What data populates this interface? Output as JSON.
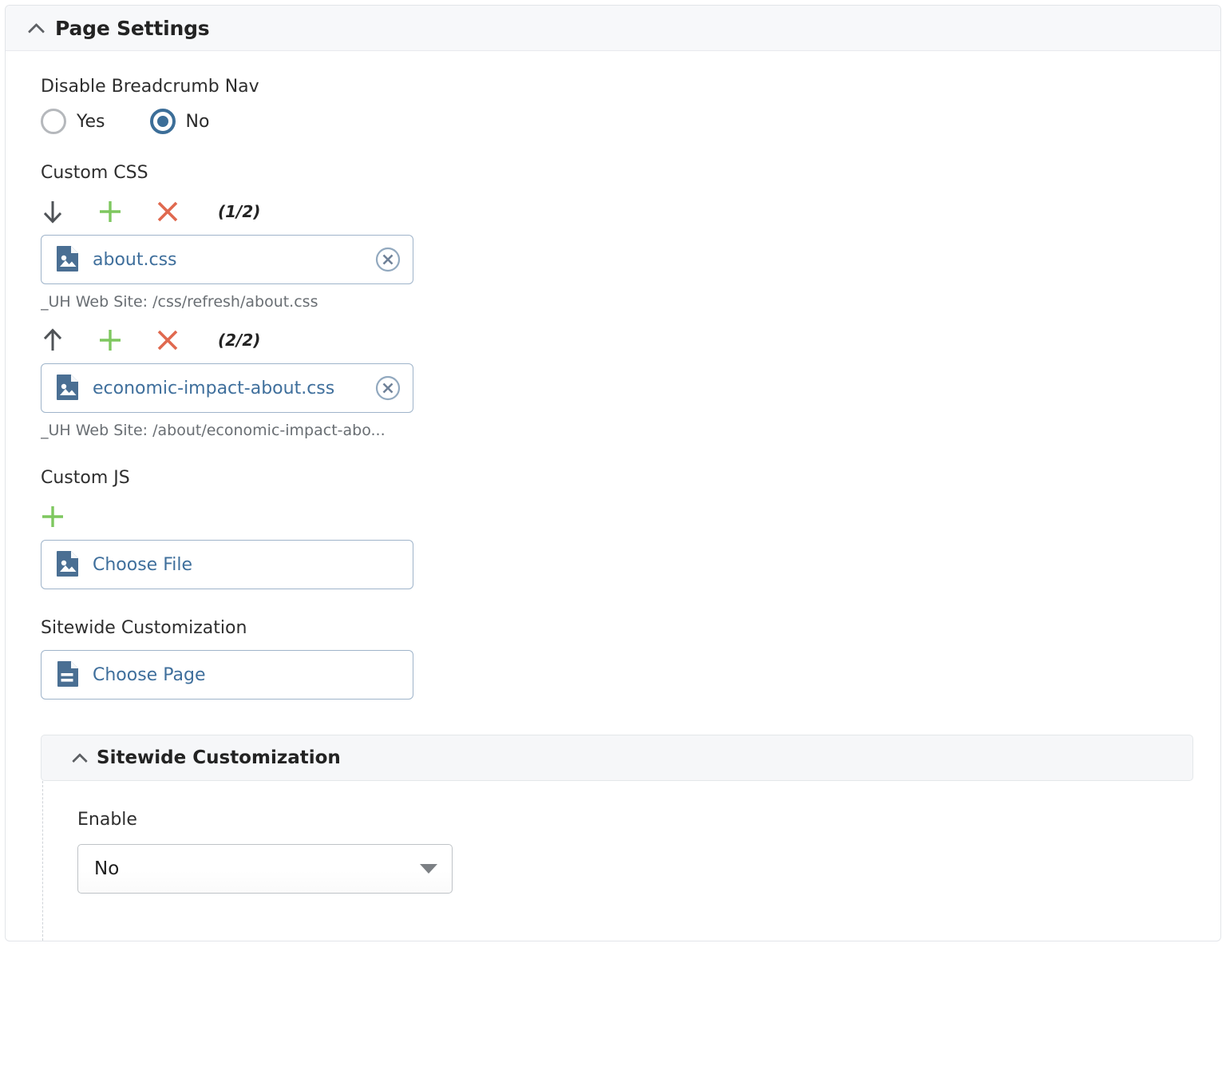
{
  "panel": {
    "title": "Page Settings",
    "collapse_icon": "chevron-up-icon"
  },
  "breadcrumb_field": {
    "label": "Disable Breadcrumb Nav",
    "options": [
      {
        "label": "Yes",
        "selected": false
      },
      {
        "label": "No",
        "selected": true
      }
    ]
  },
  "custom_css": {
    "label": "Custom CSS",
    "entries": [
      {
        "move_icon": "arrow-down-icon",
        "add_icon": "plus-icon",
        "remove_icon": "x-icon",
        "counter": "(1/2)",
        "file_icon": "file-image-icon",
        "file_name": "about.css",
        "clear_icon": "clear-circle-icon",
        "help_text": "_UH Web Site: /css/refresh/about.css"
      },
      {
        "move_icon": "arrow-up-icon",
        "add_icon": "plus-icon",
        "remove_icon": "x-icon",
        "counter": "(2/2)",
        "file_icon": "file-image-icon",
        "file_name": "economic-impact-about.css",
        "clear_icon": "clear-circle-icon",
        "help_text": "_UH Web Site: /about/economic-impact-abo..."
      }
    ]
  },
  "custom_js": {
    "label": "Custom JS",
    "add_icon": "plus-icon",
    "chooser": {
      "file_icon": "file-image-icon",
      "label": "Choose File"
    }
  },
  "sitewide_picker": {
    "label": "Sitewide Customization",
    "chooser": {
      "page_icon": "file-document-icon",
      "label": "Choose Page"
    }
  },
  "sitewide_panel": {
    "title": "Sitewide Customization",
    "collapse_icon": "chevron-up-icon",
    "enable_field": {
      "label": "Enable",
      "value": "No",
      "caret_icon": "caret-down-icon"
    }
  },
  "colors": {
    "link_blue": "#3f6f9c",
    "icon_blue": "#4a6f93",
    "plus_green": "#7ec75f",
    "x_red": "#e0694f",
    "arrow_gray": "#4f5357",
    "panel_header_bg": "#f7f8fa",
    "border": "#e2e5e9",
    "help_gray": "#696e73",
    "radio_selected": "#3c6e98"
  }
}
